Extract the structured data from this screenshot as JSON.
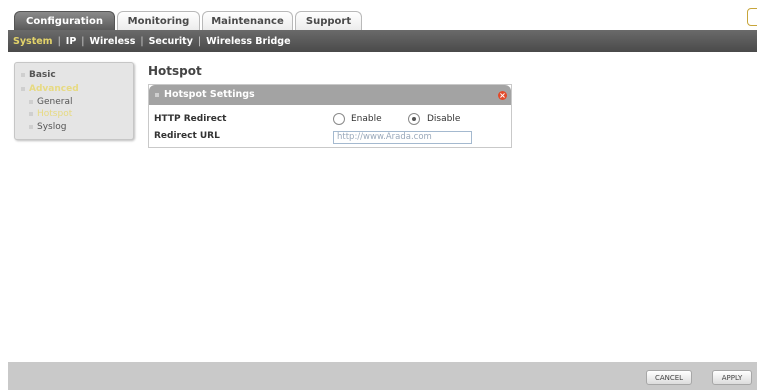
{
  "tabs": [
    {
      "label": "Configuration",
      "active": true
    },
    {
      "label": "Monitoring",
      "active": false
    },
    {
      "label": "Maintenance",
      "active": false
    },
    {
      "label": "Support",
      "active": false
    }
  ],
  "subnav": {
    "items": [
      "System",
      "IP",
      "Wireless",
      "Security",
      "Wireless Bridge"
    ],
    "active": "System"
  },
  "sidebar": {
    "basic": "Basic",
    "advanced": "Advanced",
    "general": "General",
    "hotspot": "Hotspot",
    "syslog": "Syslog"
  },
  "page": {
    "title": "Hotspot",
    "panel_title": "Hotspot Settings",
    "http_redirect_label": "HTTP Redirect",
    "enable_label": "Enable",
    "disable_label": "Disable",
    "http_redirect_value": "Disable",
    "redirect_url_label": "Redirect URL",
    "redirect_url_placeholder": "http://www.Arada.com"
  },
  "footer": {
    "cancel_label": "CANCEL",
    "apply_label": "APPLY"
  },
  "colors": {
    "accent_active": "#e7da82",
    "close": "#e34a2a"
  }
}
